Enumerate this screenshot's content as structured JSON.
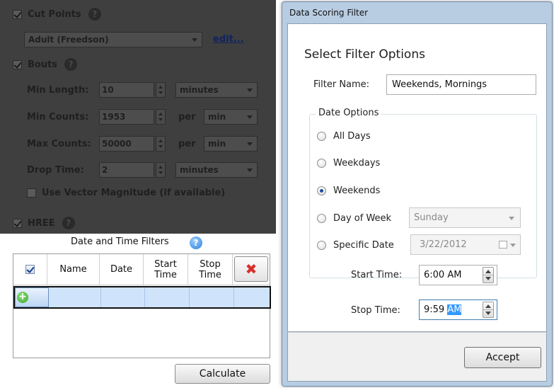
{
  "background": {
    "cut_points": {
      "label": "Cut Points",
      "preset": "Adult (Freedson)",
      "edit_link": "edit..."
    },
    "bouts": {
      "label": "Bouts",
      "min_length": {
        "label": "Min Length:",
        "value": "10",
        "unit": "minutes"
      },
      "min_counts": {
        "label": "Min Counts:",
        "value": "1953",
        "per": "per",
        "unit": "min"
      },
      "max_counts": {
        "label": "Max Counts:",
        "value": "50000",
        "per": "per",
        "unit": "min"
      },
      "drop_time": {
        "label": "Drop Time:",
        "value": "2",
        "unit": "minutes"
      },
      "vector_magnitude": "Use Vector Magnitude (if available)"
    },
    "hree": {
      "label": "HREE"
    }
  },
  "date_time_filters": {
    "title": "Date and Time Filters",
    "help_glyph": "?",
    "columns": [
      "Name",
      "Date",
      "Start\nTime",
      "Stop\nTime"
    ],
    "delete_glyph": "✖",
    "add_glyph": "+"
  },
  "calculate_label": "Calculate",
  "dialog": {
    "title": "Data Scoring Filter",
    "heading": "Select Filter Options",
    "filter_name_label": "Filter Name:",
    "filter_name_value": "Weekends, Mornings",
    "date_options": {
      "legend": "Date Options",
      "options": [
        "All Days",
        "Weekdays",
        "Weekends",
        "Day of Week",
        "Specific Date"
      ],
      "selected": "Weekends",
      "day_of_week_value": "Sunday",
      "specific_date_value": "3/22/2012"
    },
    "start_time": {
      "label": "Start Time:",
      "value": "6:00 AM"
    },
    "stop_time": {
      "label": "Stop Time:",
      "value_main": "9:59",
      "value_selected": "AM"
    },
    "accept_label": "Accept"
  },
  "colors": {
    "dim_overlay": "#3f3f3f",
    "dialog_frame": "#b8cde2",
    "row_highlight": "#cfe4fb",
    "selection": "#3399ff",
    "delete_red": "#d9302c",
    "add_green": "#3aa52a"
  },
  "icons": {
    "help": "question-circle-icon",
    "delete": "red-x-icon",
    "add": "green-plus-icon",
    "calendar": "calendar-icon"
  }
}
